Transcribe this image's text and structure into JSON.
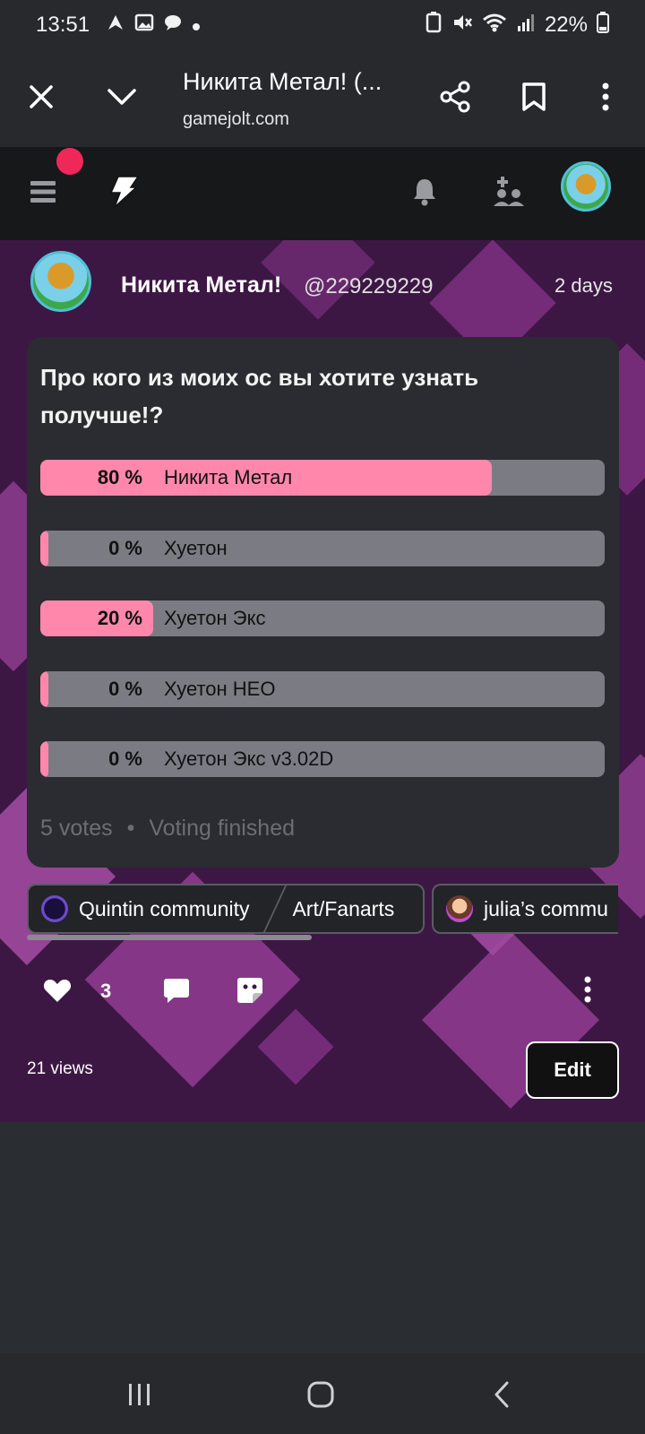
{
  "status_bar": {
    "time": "13:51",
    "battery": "22%"
  },
  "browser": {
    "title": "Никита Метал! (...",
    "url": "gamejolt.com"
  },
  "post": {
    "author_name": "Никита Метал!",
    "author_handle": "@229229229",
    "time": "2 days",
    "poll": {
      "question": "Про кого из моих ос вы хотите узнать получше!?",
      "options": [
        {
          "percent": "80 %",
          "label": "Никита Метал",
          "fraction": 0.8
        },
        {
          "percent": "0 %",
          "label": "Хуетон",
          "fraction": 0.0
        },
        {
          "percent": "20 %",
          "label": "Хуетон Экс",
          "fraction": 0.2
        },
        {
          "percent": "0 %",
          "label": "Хуетон НЕО",
          "fraction": 0.0
        },
        {
          "percent": "0 %",
          "label": "Хуетон Экс v3.02D",
          "fraction": 0.0
        }
      ],
      "votes": "5 votes",
      "status": "Voting finished"
    },
    "communities": [
      {
        "name": "Quintin community",
        "channel": "Art/Fanarts"
      },
      {
        "name": "julia’s commu"
      }
    ],
    "like_count": "3",
    "views": "21 views",
    "edit_label": "Edit"
  },
  "colors": {
    "poll_fill": "#ff87ab",
    "poll_track": "#7b7c83",
    "notification_dot": "#f0285a"
  }
}
